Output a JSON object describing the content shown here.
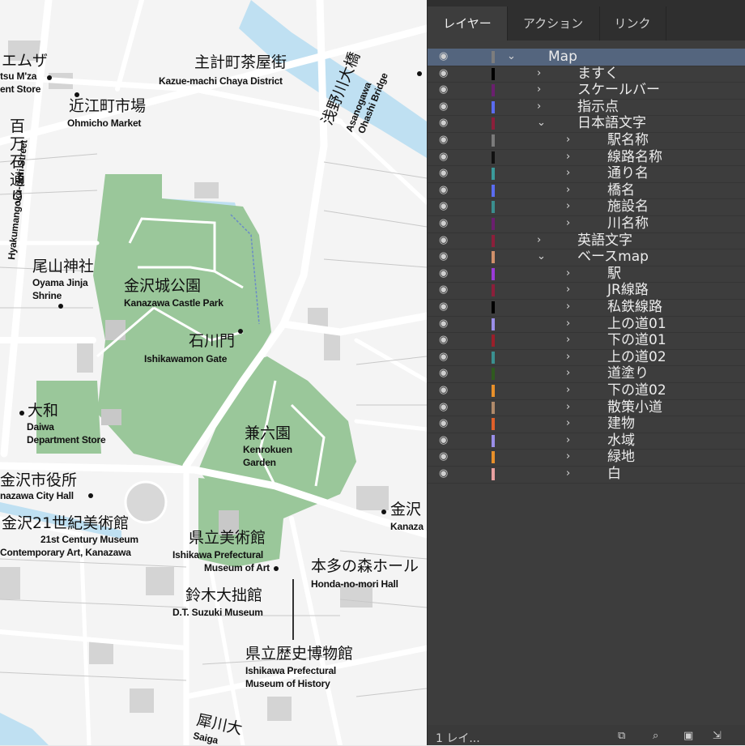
{
  "panel": {
    "tabs": [
      {
        "label": "レイヤー",
        "active": true
      },
      {
        "label": "アクション",
        "active": false
      },
      {
        "label": "リンク",
        "active": false
      }
    ],
    "layers": [
      {
        "name": "Map",
        "depth": 0,
        "expanded": true,
        "color": "#7d7d7d",
        "selected": true
      },
      {
        "name": "ますく",
        "depth": 1,
        "expanded": false,
        "color": "#000000"
      },
      {
        "name": "スケールバー",
        "depth": 1,
        "expanded": false,
        "color": "#6b1f6f"
      },
      {
        "name": "指示点",
        "depth": 1,
        "expanded": false,
        "color": "#5a6cf0"
      },
      {
        "name": "日本語文字",
        "depth": 1,
        "expanded": true,
        "color": "#8c1f3a"
      },
      {
        "name": "駅名称",
        "depth": 2,
        "expanded": false,
        "color": "#7b7b7b"
      },
      {
        "name": "線路名称",
        "depth": 2,
        "expanded": false,
        "color": "#111111"
      },
      {
        "name": "通り名",
        "depth": 2,
        "expanded": false,
        "color": "#3a9a9a"
      },
      {
        "name": "橋名",
        "depth": 2,
        "expanded": false,
        "color": "#5a6cf0"
      },
      {
        "name": "施設名",
        "depth": 2,
        "expanded": false,
        "color": "#3a8e8e"
      },
      {
        "name": "川名称",
        "depth": 2,
        "expanded": false,
        "color": "#6b1f6f"
      },
      {
        "name": "英語文字",
        "depth": 1,
        "expanded": false,
        "color": "#8c1f3a"
      },
      {
        "name": "ベースmap",
        "depth": 1,
        "expanded": true,
        "color": "#d0906a"
      },
      {
        "name": "駅",
        "depth": 2,
        "expanded": false,
        "color": "#9a3ad8"
      },
      {
        "name": "JR線路",
        "depth": 2,
        "expanded": false,
        "color": "#8c1f3a"
      },
      {
        "name": "私鉄線路",
        "depth": 2,
        "expanded": false,
        "color": "#000000"
      },
      {
        "name": "上の道01",
        "depth": 2,
        "expanded": false,
        "color": "#9a8ee8"
      },
      {
        "name": "下の道01",
        "depth": 2,
        "expanded": false,
        "color": "#9a1f2a"
      },
      {
        "name": "上の道02",
        "depth": 2,
        "expanded": false,
        "color": "#3a9090"
      },
      {
        "name": "道塗り",
        "depth": 2,
        "expanded": false,
        "color": "#2f5a1f"
      },
      {
        "name": "下の道02",
        "depth": 2,
        "expanded": false,
        "color": "#e8902a"
      },
      {
        "name": "散策小道",
        "depth": 2,
        "expanded": false,
        "color": "#b08a6a"
      },
      {
        "name": "建物",
        "depth": 2,
        "expanded": false,
        "color": "#e0602a"
      },
      {
        "name": "水域",
        "depth": 2,
        "expanded": false,
        "color": "#9a8ee8"
      },
      {
        "name": "緑地",
        "depth": 2,
        "expanded": false,
        "color": "#e8902a"
      },
      {
        "name": "白",
        "depth": 2,
        "expanded": false,
        "color": "#e8a0a0"
      }
    ],
    "footer": {
      "text": "1 レイ..."
    }
  },
  "map": {
    "labels": [
      {
        "id": "emuza-jp",
        "text": "エムザ"
      },
      {
        "id": "emuza-en1",
        "text": "tsu M'za"
      },
      {
        "id": "emuza-en2",
        "text": "ent Store"
      },
      {
        "id": "chaya-jp",
        "text": "主計町茶屋街"
      },
      {
        "id": "chaya-en",
        "text": "Kazue-machi Chaya District"
      },
      {
        "id": "ohmicho-jp",
        "text": "近江町市場"
      },
      {
        "id": "ohmicho-en",
        "text": "Ohmicho Market"
      },
      {
        "id": "bridge-jp",
        "text": "浅野川大橋"
      },
      {
        "id": "bridge-en1",
        "text": "Asanogawa"
      },
      {
        "id": "bridge-en2",
        "text": "Ohashi Bridge"
      },
      {
        "id": "hyakuman-jp",
        "text": "百万石通り"
      },
      {
        "id": "hyakuman-en",
        "text": "Hyakumangoku-dori Street"
      },
      {
        "id": "oyama-jp",
        "text": "尾山神社"
      },
      {
        "id": "oyama-en1",
        "text": "Oyama Jinja"
      },
      {
        "id": "oyama-en2",
        "text": "Shrine"
      },
      {
        "id": "castle-jp",
        "text": "金沢城公園"
      },
      {
        "id": "castle-en",
        "text": "Kanazawa Castle Park"
      },
      {
        "id": "ishikawamon-jp",
        "text": "石川門"
      },
      {
        "id": "ishikawamon-en",
        "text": "Ishikawamon Gate"
      },
      {
        "id": "daiwa-jp",
        "text": "大和"
      },
      {
        "id": "daiwa-en1",
        "text": "Daiwa"
      },
      {
        "id": "daiwa-en2",
        "text": "Department Store"
      },
      {
        "id": "kenrokuen-jp",
        "text": "兼六園"
      },
      {
        "id": "kenrokuen-en1",
        "text": "Kenrokuen"
      },
      {
        "id": "kenrokuen-en2",
        "text": "Garden"
      },
      {
        "id": "cityhall-jp",
        "text": "金沢市役所"
      },
      {
        "id": "cityhall-en",
        "text": "nazawa City Hall"
      },
      {
        "id": "museum21-jp",
        "text": "金沢21世紀美術館"
      },
      {
        "id": "museum21-en1",
        "text": "21st Century Museum"
      },
      {
        "id": "museum21-en2",
        "text": "Contemporary Art, Kanazawa"
      },
      {
        "id": "kenritsu-jp",
        "text": "県立美術館"
      },
      {
        "id": "kenritsu-en1",
        "text": "Ishikawa Prefectural"
      },
      {
        "id": "kenritsu-en2",
        "text": "Museum of Art"
      },
      {
        "id": "honda-jp",
        "text": "本多の森ホール"
      },
      {
        "id": "honda-en",
        "text": "Honda-no-mori Hall"
      },
      {
        "id": "suzuki-jp",
        "text": "鈴木大拙館"
      },
      {
        "id": "suzuki-en",
        "text": "D.T. Suzuki Museum"
      },
      {
        "id": "history-jp",
        "text": "県立歴史博物館"
      },
      {
        "id": "history-en1",
        "text": "Ishikawa Prefectural"
      },
      {
        "id": "history-en2",
        "text": "Museum of History"
      },
      {
        "id": "kanaza-jp",
        "text": "金沢"
      },
      {
        "id": "kanaza-en",
        "text": "Kanaza"
      },
      {
        "id": "saigawa-jp",
        "text": "犀川大"
      },
      {
        "id": "saigawa-en",
        "text": "Saiga"
      }
    ]
  },
  "colors": {
    "panel_bg": "#3d3d3d",
    "selection": "#54657e",
    "park_green": "#9ac79a",
    "water": "#bfe0f2",
    "building": "#d4d4d4"
  },
  "icons": [
    "eye-icon",
    "chevron-right-icon",
    "chevron-down-icon",
    "new-layer-icon",
    "search-icon",
    "duplicate-icon",
    "delete-icon"
  ]
}
